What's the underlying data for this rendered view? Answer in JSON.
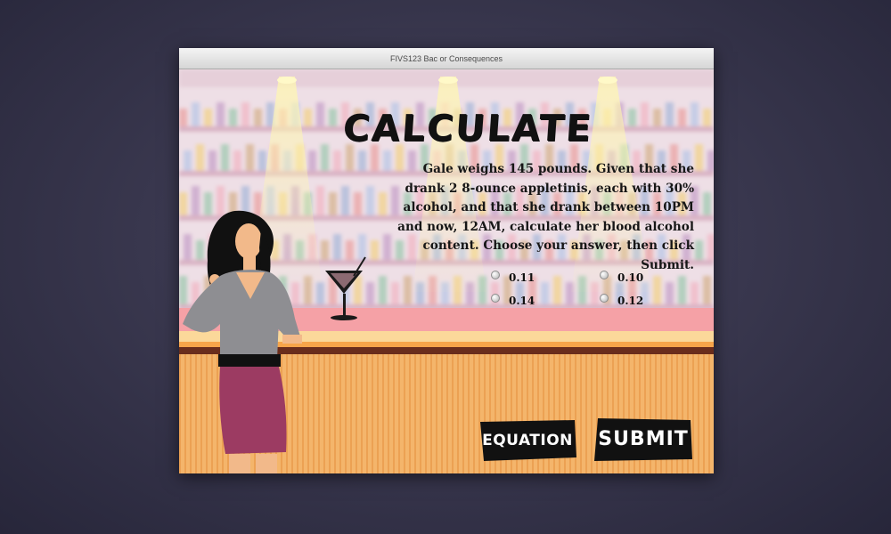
{
  "window": {
    "title": "FIVS123 Bac or Consequences"
  },
  "screen": {
    "heading": "Calculate",
    "question": "Gale weighs 145 pounds. Given that she drank 2 8-ounce appletinis, each with 30% alcohol, and that she drank between 10PM and now, 12AM, calculate her blood alcohol content. Choose your answer, then click Submit.",
    "choices": [
      {
        "label": "0.11",
        "selected": false
      },
      {
        "label": "0.10",
        "selected": false
      },
      {
        "label": "0.14",
        "selected": false
      },
      {
        "label": "0.12",
        "selected": false
      }
    ],
    "buttons": {
      "equation": "Equation",
      "submit": "Submit"
    }
  },
  "colors": {
    "wall": "#f0e4e8",
    "bar_top": "#f5a1a6",
    "bar_front": "#f4b56b",
    "bar_stripe": "#e58f3f",
    "button_bg": "#111111",
    "top_bold": "#7a4b64"
  }
}
